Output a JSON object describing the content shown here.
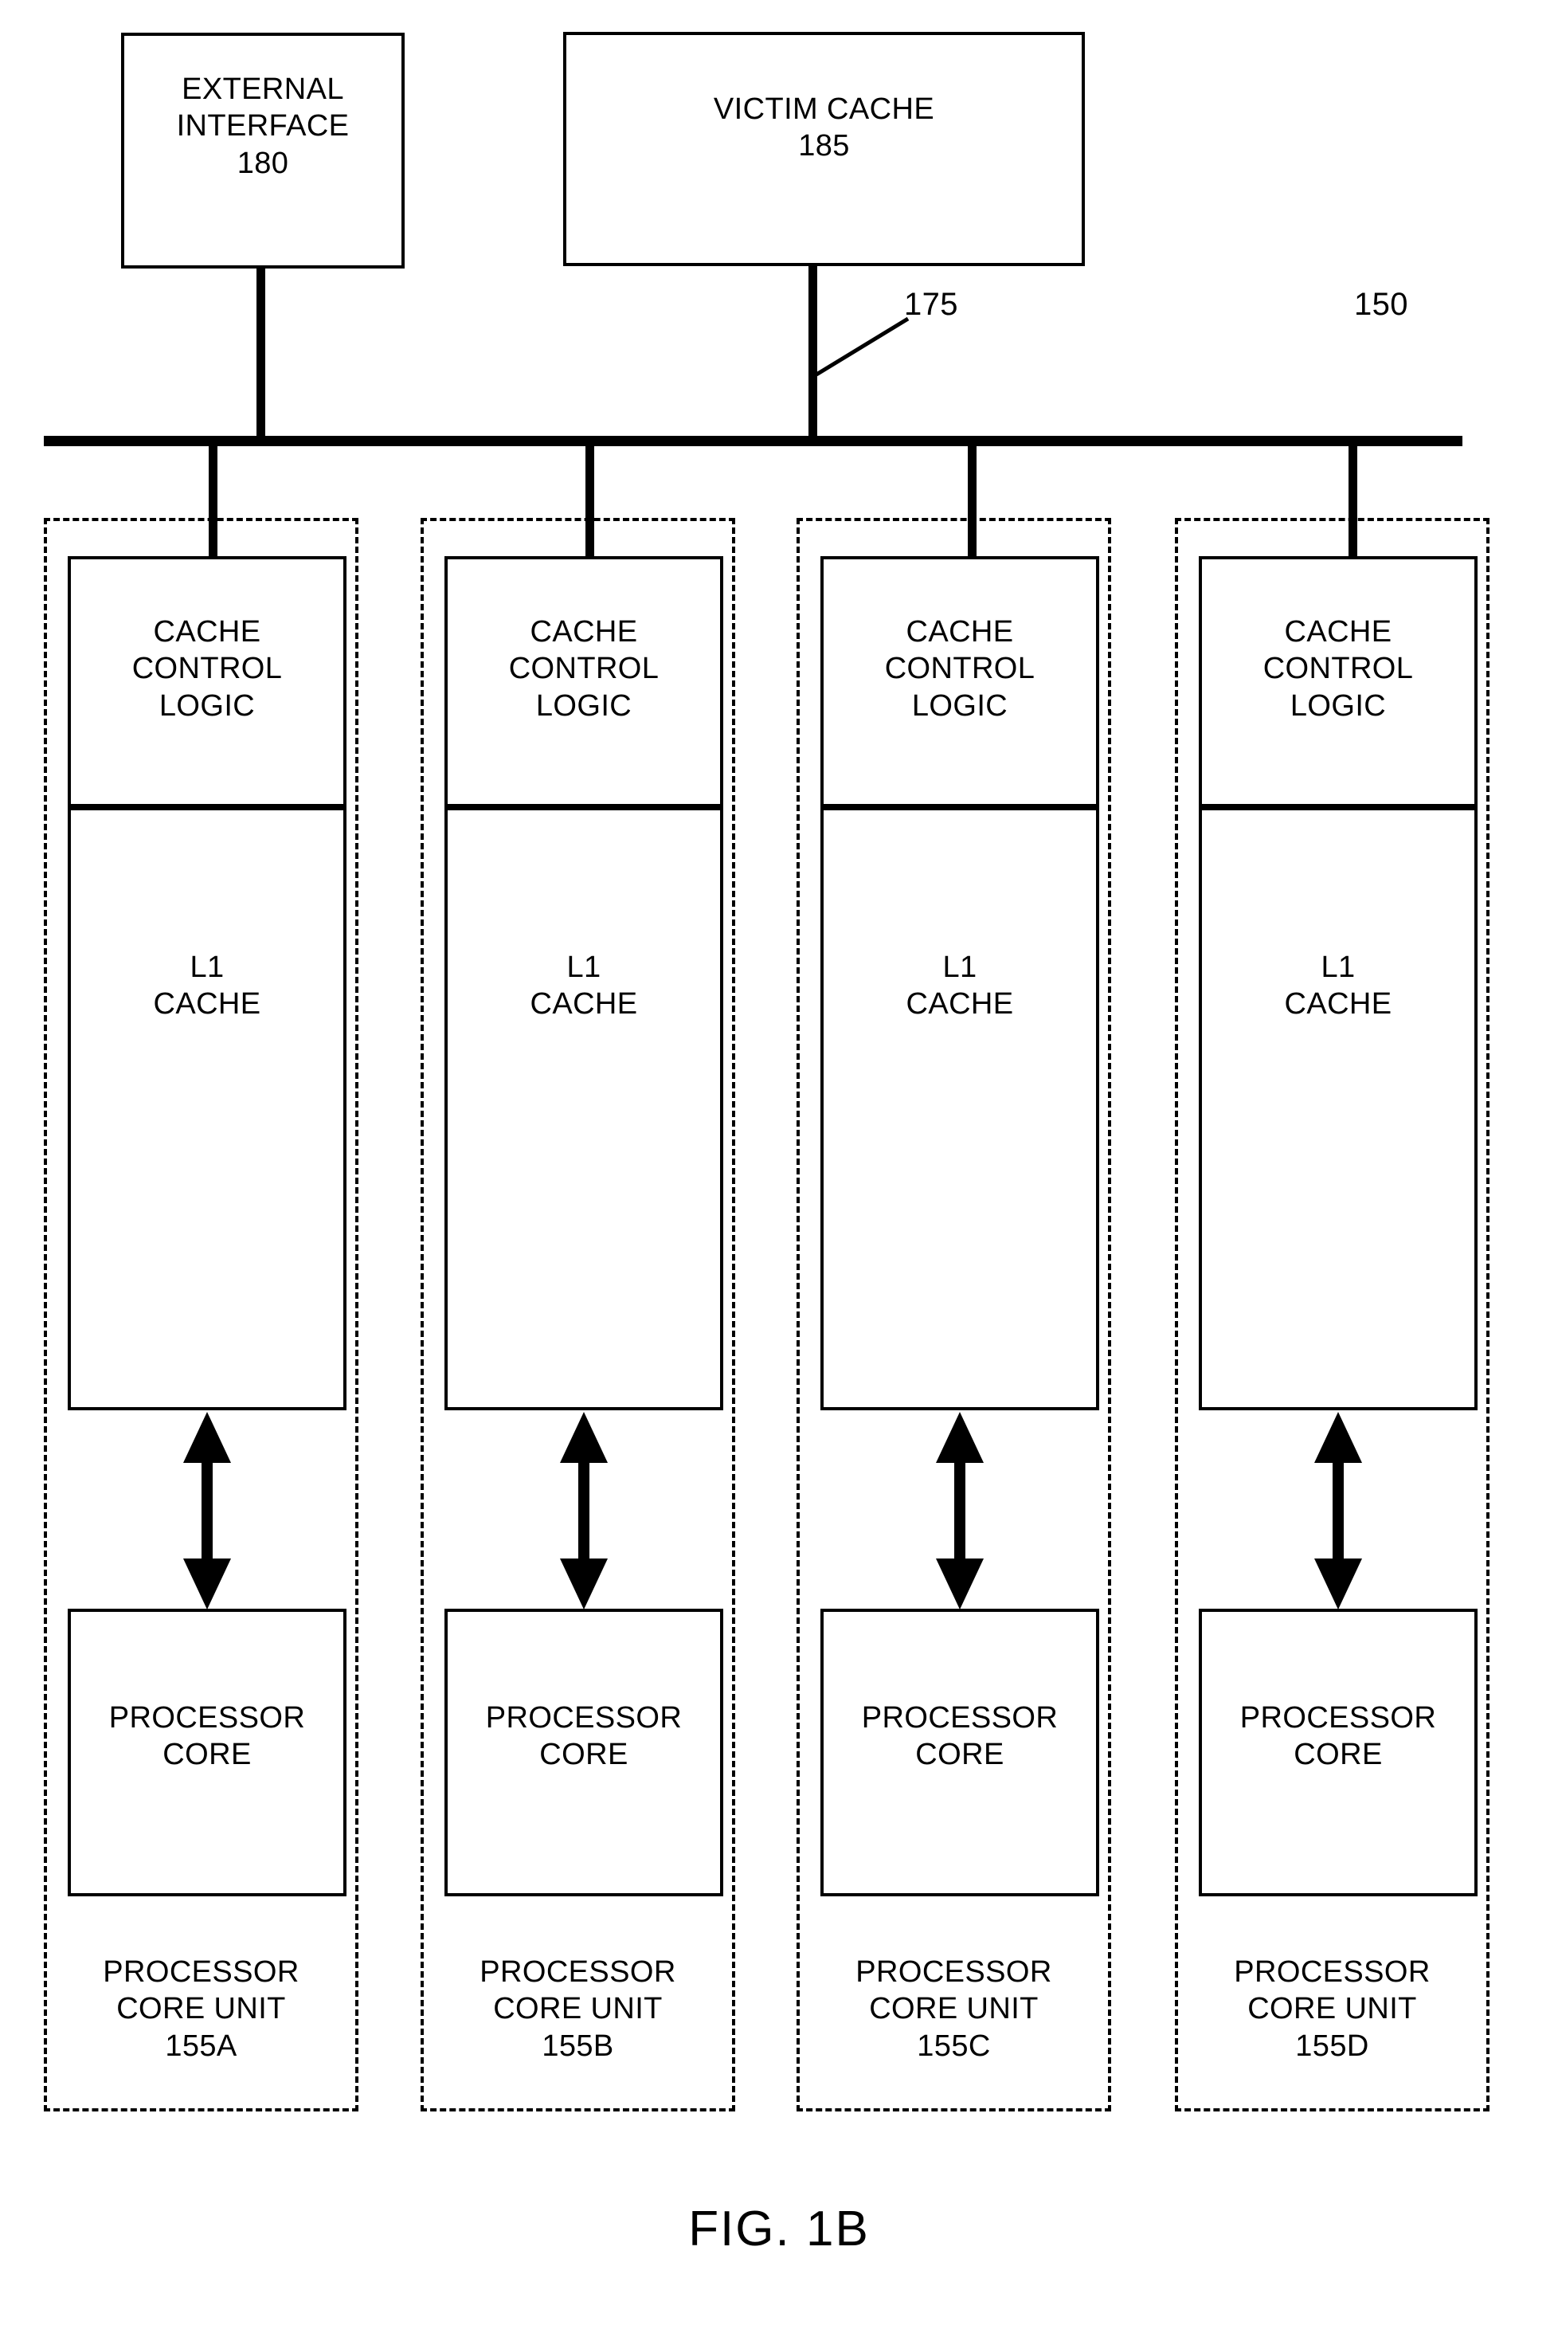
{
  "figure": {
    "caption": "FIG. 1B",
    "system_ref": "150",
    "bus_ref": "175"
  },
  "top_blocks": [
    {
      "name": "external-interface",
      "title": "EXTERNAL\nINTERFACE",
      "ref": "180",
      "label": "EXTERNAL\nINTERFACE\n180"
    },
    {
      "name": "victim-cache",
      "title": "VICTIM CACHE",
      "ref": "185",
      "label": "VICTIM CACHE\n185"
    }
  ],
  "common": {
    "cache_control_logic": "CACHE\nCONTROL\nLOGIC",
    "l1_cache": "L1\nCACHE",
    "processor_core": "PROCESSOR\nCORE",
    "unit_title": "PROCESSOR\nCORE UNIT"
  },
  "core_units": [
    {
      "ref": "155A",
      "label": "PROCESSOR\nCORE UNIT\n155A",
      "cache_control_logic": "CACHE\nCONTROL\nLOGIC",
      "l1_cache": "L1\nCACHE",
      "processor_core": "PROCESSOR\nCORE"
    },
    {
      "ref": "155B",
      "label": "PROCESSOR\nCORE UNIT\n155B",
      "cache_control_logic": "CACHE\nCONTROL\nLOGIC",
      "l1_cache": "L1\nCACHE",
      "processor_core": "PROCESSOR\nCORE"
    },
    {
      "ref": "155C",
      "label": "PROCESSOR\nCORE UNIT\n155C",
      "cache_control_logic": "CACHE\nCONTROL\nLOGIC",
      "l1_cache": "L1\nCACHE",
      "processor_core": "PROCESSOR\nCORE"
    },
    {
      "ref": "155D",
      "label": "PROCESSOR\nCORE UNIT\n155D",
      "cache_control_logic": "CACHE\nCONTROL\nLOGIC",
      "l1_cache": "L1\nCACHE",
      "processor_core": "PROCESSOR\nCORE"
    }
  ],
  "colors": {
    "stroke": "#000000",
    "background": "#ffffff"
  }
}
